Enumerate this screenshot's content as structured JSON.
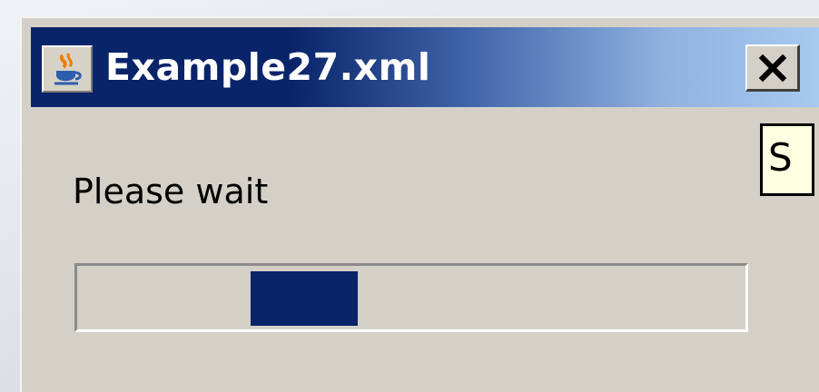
{
  "window": {
    "title": "Example27.xml",
    "icon": "java-coffee-cup-icon",
    "close_icon": "close-x-icon"
  },
  "dialog": {
    "message": "Please wait",
    "progress": {
      "mode": "indeterminate",
      "block_start_fraction": 0.26,
      "block_width_fraction": 0.16
    }
  },
  "tooltip": {
    "text": "S"
  },
  "colors": {
    "title_start": "#0a246a",
    "title_end": "#a6caf0",
    "window_bg": "#d4d0c8",
    "progress_fill": "#0a246a",
    "tooltip_bg": "#ffffe1"
  }
}
